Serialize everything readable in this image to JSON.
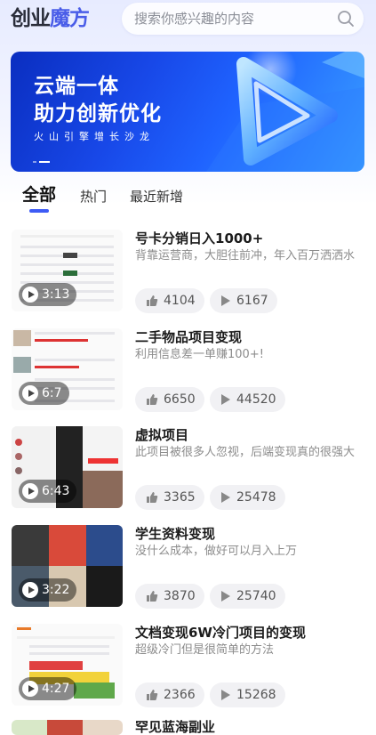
{
  "header": {
    "logo_part1": "创业",
    "logo_part2": "魔方",
    "search_placeholder": "搜索你感兴趣的内容"
  },
  "banner": {
    "line1": "云端一体",
    "line2": "助力创新优化",
    "line3": "火山引擎增长沙龙"
  },
  "tabs": [
    {
      "label": "全部",
      "active": true
    },
    {
      "label": "热门",
      "active": false
    },
    {
      "label": "最近新增",
      "active": false
    }
  ],
  "items": [
    {
      "title": "号卡分销日入1000+",
      "desc": "背靠运营商，大胆往前冲，年入百万洒洒水",
      "duration": "3:13",
      "likes": "4104",
      "plays": "6167"
    },
    {
      "title": "二手物品项目变现",
      "desc": "利用信息差一单赚100+!",
      "duration": "6:7",
      "likes": "6650",
      "plays": "44520"
    },
    {
      "title": "虚拟项目",
      "desc": "此项目被很多人忽视，后端变现真的很强大",
      "duration": "6:43",
      "likes": "3365",
      "plays": "25478"
    },
    {
      "title": "学生资料变现",
      "desc": "没什么成本，做好可以月入上万",
      "duration": "3:22",
      "likes": "3870",
      "plays": "25740"
    },
    {
      "title": "文档变现6W冷门项目的变现",
      "desc": "超级冷门但是很简单的方法",
      "duration": "4:27",
      "likes": "2366",
      "plays": "15268"
    },
    {
      "title": "罕见蓝海副业",
      "desc": "",
      "duration": "",
      "likes": "",
      "plays": ""
    }
  ],
  "colors": {
    "accent": "#3d5bf5",
    "logo_brand": "#4a5de8",
    "banner_blue": "#1f63ff"
  },
  "icons": {
    "search": "search-icon",
    "play": "play-icon",
    "like": "thumbs-up-icon",
    "views": "play-count-icon"
  }
}
